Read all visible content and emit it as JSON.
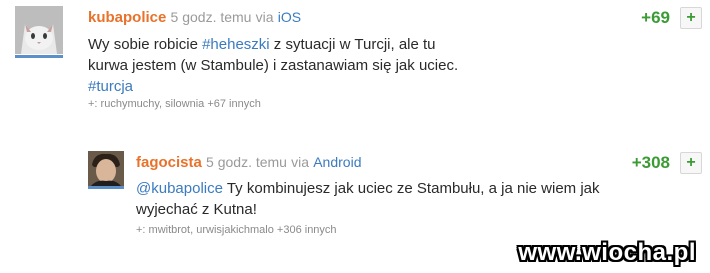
{
  "entries": [
    {
      "author": "kubapolice",
      "time": "5 godz. temu",
      "via": "via",
      "app": "iOS",
      "score": "+69",
      "plus": "+",
      "body_pre": "Wy sobie robicie ",
      "tag": "#heheszki",
      "body_post": " z sytuacji w Turcji, ale tu kurwa jestem (w Stambule) i zastanawiam się jak uciec.",
      "tag2": "#turcja",
      "voters_prefix": "+:",
      "voters": "ruchymuchy, silownia +67 innych"
    },
    {
      "author": "fagocista",
      "time": "5 godz. temu",
      "via": "via",
      "app": "Android",
      "score": "+308",
      "plus": "+",
      "mention": "@kubapolice",
      "body_post": " Ty kombinujesz jak uciec ze Stambułu, a ja nie wiem jak wyjechać z Kutna!",
      "voters_prefix": "+:",
      "voters": "mwitbrot, urwisjakichmalo +306 innych"
    }
  ],
  "watermark": "www.wiocha.pl",
  "colors": {
    "author": "#e8722b",
    "score": "#3b9b34",
    "link": "#3b7bbf",
    "meta": "#9a9a9a"
  }
}
